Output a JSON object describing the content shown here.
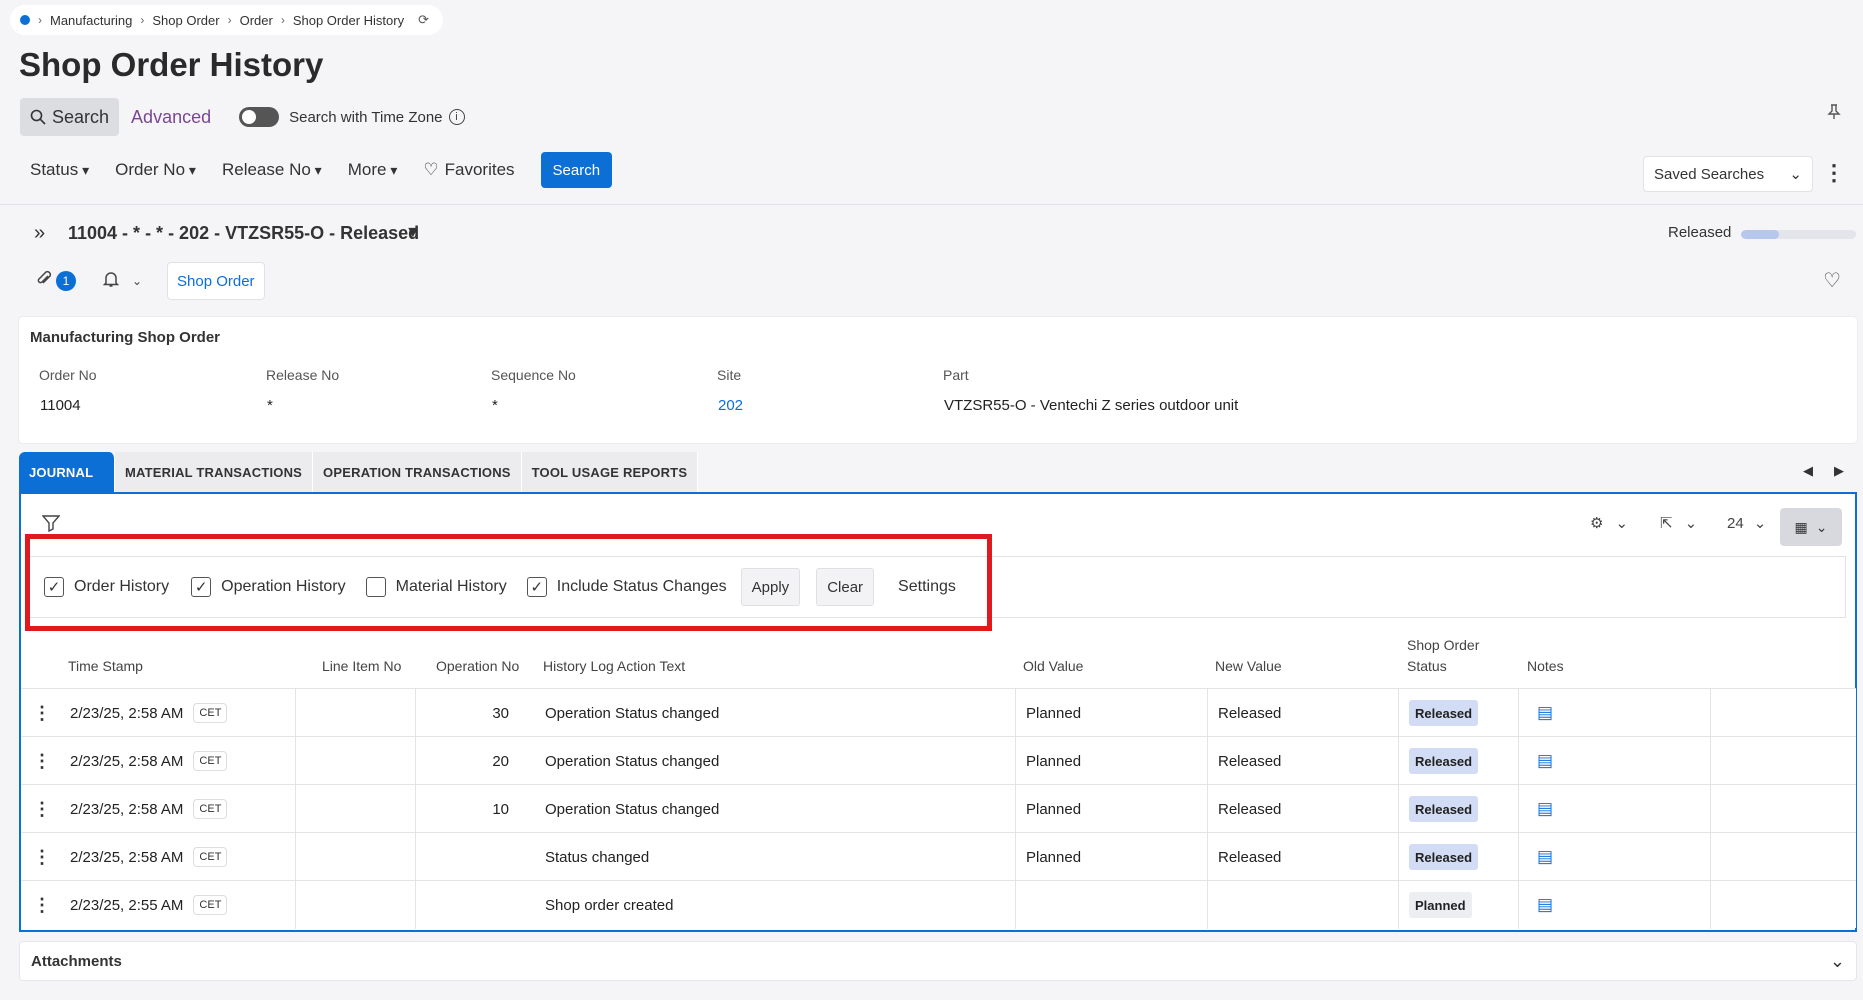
{
  "breadcrumb": [
    "Manufacturing",
    "Shop Order",
    "Order",
    "Shop Order History"
  ],
  "page_title": "Shop Order History",
  "search_mode": {
    "search": "Search",
    "advanced": "Advanced",
    "timezone_toggle": "Search with Time Zone"
  },
  "filters": {
    "status": "Status",
    "order_no": "Order No",
    "release_no": "Release No",
    "more": "More",
    "favorites": "Favorites",
    "search_button": "Search",
    "saved_searches": "Saved Searches"
  },
  "record": {
    "title": "11004 - * - * - 202 - VTZSR55-O - Released",
    "status": "Released",
    "status_progress": 0.33,
    "attachments_count": "1",
    "shop_order_link": "Shop Order"
  },
  "card": {
    "title": "Manufacturing Shop Order",
    "order_no_label": "Order No",
    "order_no": "11004",
    "release_no_label": "Release No",
    "release_no": "*",
    "sequence_no_label": "Sequence No",
    "sequence_no": "*",
    "site_label": "Site",
    "site": "202",
    "part_label": "Part",
    "part": "VTZSR55-O - Ventechi Z series outdoor unit"
  },
  "tabs": [
    "JOURNAL",
    "MATERIAL TRANSACTIONS",
    "OPERATION TRANSACTIONS",
    "TOOL USAGE REPORTS"
  ],
  "toolbar": {
    "page_size": "24"
  },
  "history_filter": {
    "order_history": {
      "label": "Order History",
      "checked": true
    },
    "operation_history": {
      "label": "Operation History",
      "checked": true
    },
    "material_history": {
      "label": "Material History",
      "checked": false
    },
    "status_changes": {
      "label": "Include Status Changes",
      "checked": true
    },
    "apply": "Apply",
    "clear": "Clear",
    "settings": "Settings"
  },
  "table": {
    "headers": {
      "time_stamp": "Time Stamp",
      "line_item_no": "Line Item No",
      "operation_no": "Operation No",
      "action_text": "History Log Action Text",
      "old_value": "Old Value",
      "new_value": "New Value",
      "status_line1": "Shop Order",
      "status_line2": "Status",
      "notes": "Notes"
    },
    "rows": [
      {
        "time": "2/23/25, 2:58 AM",
        "tz": "CET",
        "line_item": "",
        "op_no": "30",
        "action": "Operation Status changed",
        "old": "Planned",
        "new": "Released",
        "status": "Released"
      },
      {
        "time": "2/23/25, 2:58 AM",
        "tz": "CET",
        "line_item": "",
        "op_no": "20",
        "action": "Operation Status changed",
        "old": "Planned",
        "new": "Released",
        "status": "Released"
      },
      {
        "time": "2/23/25, 2:58 AM",
        "tz": "CET",
        "line_item": "",
        "op_no": "10",
        "action": "Operation Status changed",
        "old": "Planned",
        "new": "Released",
        "status": "Released"
      },
      {
        "time": "2/23/25, 2:58 AM",
        "tz": "CET",
        "line_item": "",
        "op_no": "",
        "action": "Status changed",
        "old": "Planned",
        "new": "Released",
        "status": "Released"
      },
      {
        "time": "2/23/25, 2:55 AM",
        "tz": "CET",
        "line_item": "",
        "op_no": "",
        "action": "Shop order created",
        "old": "",
        "new": "",
        "status": "Planned"
      }
    ]
  },
  "attachments_section": "Attachments",
  "colors": {
    "accent": "#0b6fd6",
    "highlight": "#e0191f",
    "released_pill": "#d2dcf4"
  }
}
